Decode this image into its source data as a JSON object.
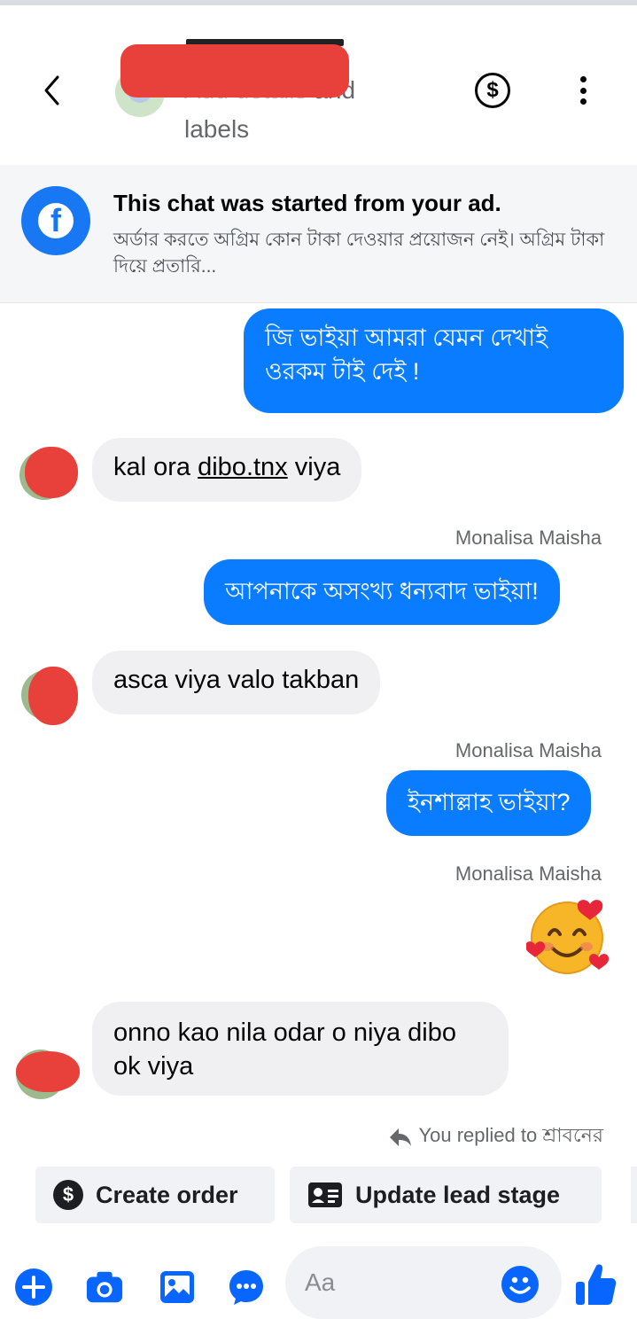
{
  "header": {
    "subtitle_hidden": "Add details ",
    "subtitle_visible": "and labels",
    "dollar_glyph": "$"
  },
  "ad_banner": {
    "title": "This chat was started from your ad.",
    "text": "অর্ডার করতে অগ্রিম কোন টাকা দেওয়ার প্রয়োজন নেই। অগ্রিম টাকা দিয়ে প্রতারি...",
    "logo_letter": "f"
  },
  "messages": {
    "out1": "জি ভাইয়া আমরা যেমন দেখাই ওরকম টাই দেই !",
    "in1_a": "kal ora ",
    "in1_link": "dibo.tnx",
    "in1_b": " viya",
    "label1": "Monalisa Maisha",
    "out2": "আপনাকে অসংখ্য ধন্যবাদ ভাইয়া!",
    "in2": "asca viya valo takban",
    "label2": "Monalisa Maisha",
    "out3": "ইনশাল্লাহ ভাইয়া?",
    "label3": "Monalisa Maisha",
    "in3": "onno kao nila odar o niya dibo ok viya",
    "replied": "You replied to শ্রাবনের"
  },
  "actions": {
    "create_order": "Create order",
    "update_lead_stage": "Update lead stage"
  },
  "composer": {
    "placeholder": "Aa"
  },
  "colors": {
    "accent": "#0a7cff",
    "incoming_bubble": "#f0f0f3",
    "brand": "#1877f2"
  }
}
